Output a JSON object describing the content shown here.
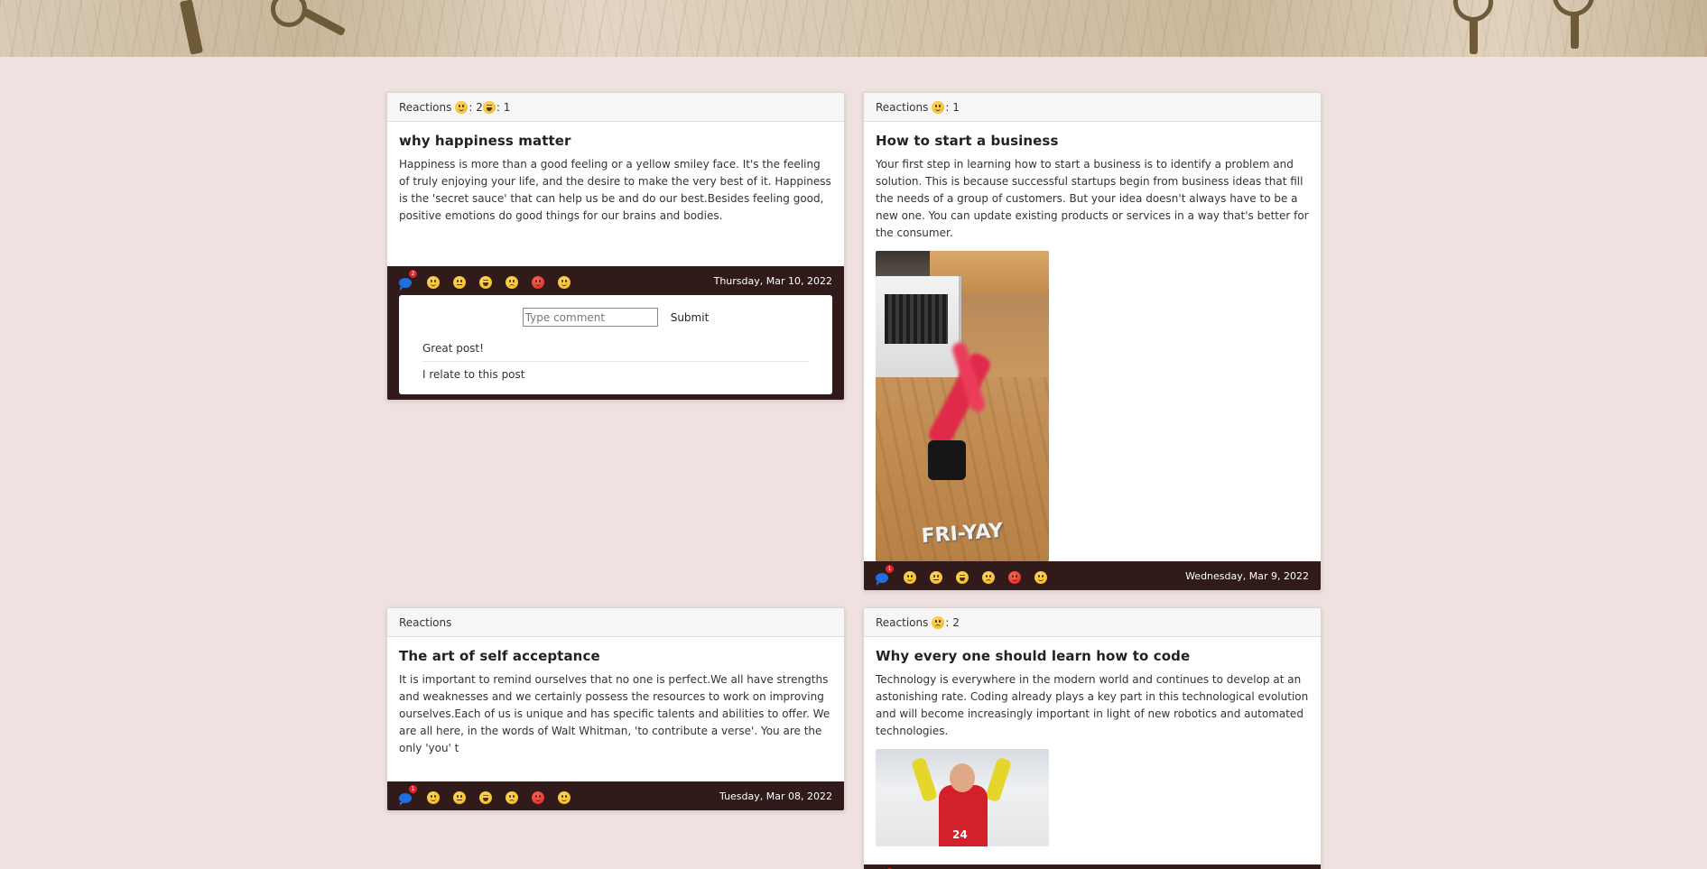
{
  "posts": [
    {
      "reactions_label": "Reactions",
      "reactions": [
        {
          "emoji": "smile",
          "count_text": ": 2"
        },
        {
          "emoji": "laugh",
          "count_text": ": 1"
        }
      ],
      "title": "why happiness matter",
      "body": "Happiness is more than a good feeling or a yellow smiley face. It's the feeling of truly enjoying your life, and the desire to make the very best of it. Happiness is the 'secret sauce' that can help us be and do our best.Besides feeling good, positive emotions do good things for our brains and bodies.",
      "comment_count": "2",
      "date": "Thursday, Mar 10, 2022",
      "comment_placeholder": "Type comment",
      "submit_label": "Submit",
      "comments": [
        "Great post!",
        "I relate to this post"
      ]
    },
    {
      "reactions_label": "Reactions",
      "reactions": [
        {
          "emoji": "smile",
          "count_text": ": 1"
        }
      ],
      "title": "How to start a business",
      "body": "Your first step in learning how to start a business is to identify a problem and solution. This is because successful startups begin from business ideas that fill the needs of a group of customers. But your idea doesn't always have to be a new one. You can update existing products or services in a way that's better for the consumer.",
      "media_caption": "FRI-YAY",
      "comment_count": "1",
      "date": "Wednesday, Mar 9, 2022"
    },
    {
      "reactions_label": "Reactions",
      "reactions": [],
      "title": "The art of self acceptance",
      "body": "It is important to remind ourselves that no one is perfect.We all have strengths and weaknesses and we certainly possess the resources to work on improving ourselves.Each of us is unique and has specific talents and abilities to offer. We are all here, in the words of Walt Whitman, 'to contribute a verse'. You are the only 'you' t",
      "comment_count": "1",
      "date": "Tuesday, Mar 08, 2022"
    },
    {
      "reactions_label": "Reactions",
      "reactions": [
        {
          "emoji": "sad",
          "count_text": ": 2"
        }
      ],
      "title": "Why every one should learn how to code",
      "body": "Technology is everywhere in the modern world and continues to develop at an astonishing rate. Coding already plays a key part in this technological evolution and will become increasingly important in light of new robotics and automated technologies.",
      "media_caption": "24",
      "comment_count": "1"
    }
  ],
  "reaction_buttons": [
    "smile-icon",
    "neutral-icon",
    "laugh-icon",
    "sad-icon",
    "angry-icon",
    "smile-icon"
  ],
  "colors": {
    "page_bg": "#eee1e0",
    "footer_bg": "#311a1a",
    "comment_icon": "#1f6fe0",
    "badge": "#e0252e"
  }
}
